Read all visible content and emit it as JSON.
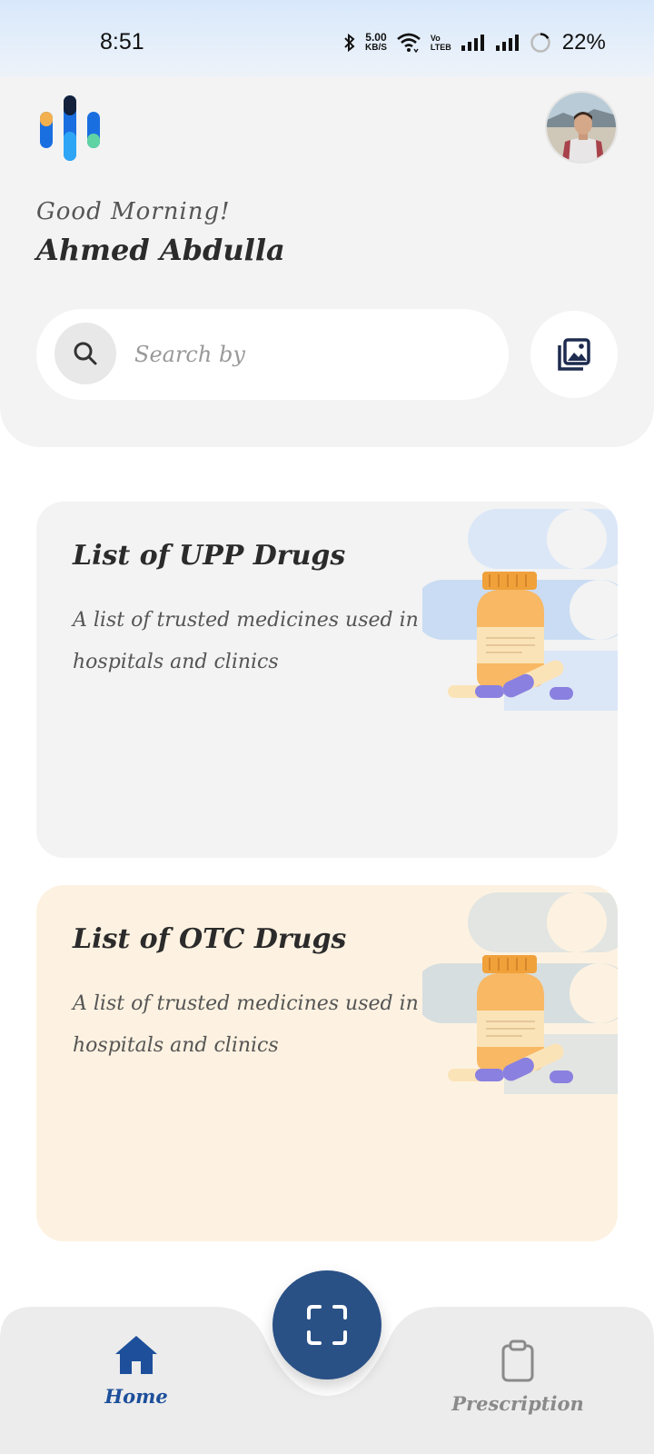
{
  "status_bar": {
    "time": "8:51",
    "network_speed_value": "5.00",
    "network_speed_unit": "KB/S",
    "volte_top": "Vo",
    "volte_bottom": "LTE",
    "volte_sub": "B",
    "battery_percent": "22%",
    "icons": [
      "bluetooth-icon",
      "wifi-icon",
      "signal-icon",
      "signal-icon",
      "battery-icon"
    ]
  },
  "header": {
    "greeting": "Good Morning!",
    "user_name": "Ahmed Abdulla"
  },
  "search": {
    "placeholder": "Search by",
    "value": ""
  },
  "cards": [
    {
      "title": "List of UPP Drugs",
      "description": "A list of trusted medicines used in hospitals and clinics",
      "background": "#f3f3f3"
    },
    {
      "title": "List of OTC Drugs",
      "description": "A list of trusted medicines used in hospitals and clinics",
      "background": "#fdf2e1"
    }
  ],
  "bottom_nav": {
    "home_label": "Home",
    "prescription_label": "Prescription",
    "active": "Home"
  },
  "colors": {
    "accent": "#1d4f9b",
    "scan_button": "#2a5186",
    "inactive": "#8a8a8a"
  }
}
